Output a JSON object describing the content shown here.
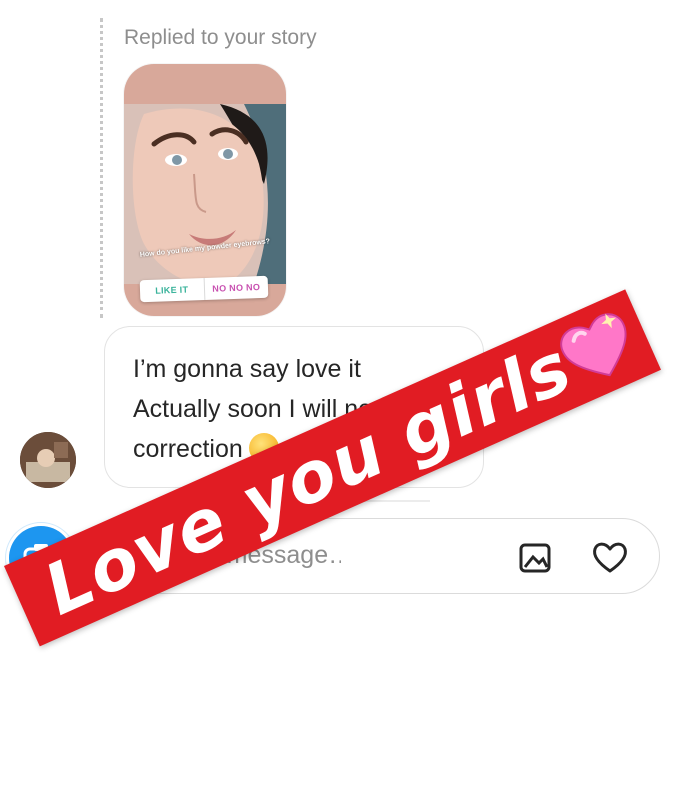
{
  "story_reply": {
    "label": "Replied to your story",
    "caption": "How do you like my powder eyebrows?",
    "poll_options": [
      "LIKE IT",
      "NO NO NO"
    ]
  },
  "message": {
    "lines": [
      "I’m gonna say love it",
      "Actually soon I will need",
      "correction"
    ],
    "emoji": "smirking-face"
  },
  "composer": {
    "placeholder": "Write a message…",
    "icons": [
      "camera-icon",
      "gallery-icon",
      "heart-icon"
    ],
    "accent_color": "#1d96f0"
  },
  "sticker": {
    "text": "Love you girls",
    "emoji": "sparkling-heart",
    "background": "#e11c23"
  }
}
